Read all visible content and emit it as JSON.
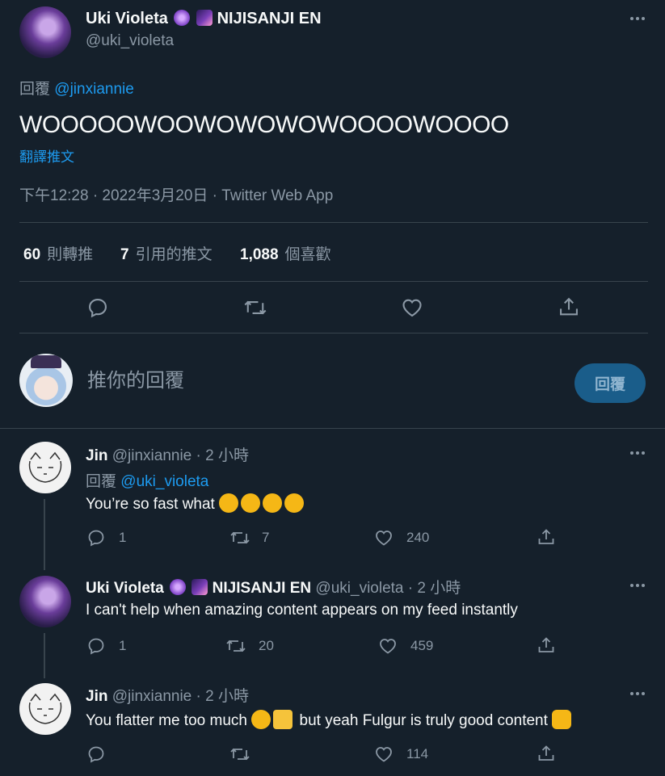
{
  "main_tweet": {
    "author_name": "Uki Violeta",
    "author_suffix": "NIJISANJI EN",
    "author_handle": "@uki_violeta",
    "reply_prefix": "回覆",
    "reply_to": "@jinxiannie",
    "text": "WOOOOOWOOWOWOWOWOOOOWOOOO",
    "translate": "翻譯推文",
    "timestamp": "下午12:28 · 2022年3月20日 · Twitter Web App",
    "retweets_count": "60",
    "retweets_label": "則轉推",
    "quotes_count": "7",
    "quotes_label": "引用的推文",
    "likes_count": "1,088",
    "likes_label": "個喜歡"
  },
  "compose": {
    "placeholder": "推你的回覆",
    "button_label": "回覆"
  },
  "replies": [
    {
      "author_name": "Jin",
      "author_handle": "@jinxiannie",
      "time": "· 2 小時",
      "reply_prefix": "回覆",
      "reply_to": "@uki_violeta",
      "text": "You’re so fast what",
      "reply_count": "1",
      "retweet_count": "7",
      "like_count": "240"
    },
    {
      "author_name": "Uki Violeta",
      "author_suffix": "NIJISANJI EN",
      "author_handle": "@uki_violeta",
      "time": "· 2 小時",
      "text": "I can't help when amazing content appears on my feed instantly",
      "reply_count": "1",
      "retweet_count": "20",
      "like_count": "459"
    },
    {
      "author_name": "Jin",
      "author_handle": "@jinxiannie",
      "time": "· 2 小時",
      "text_a": "You flatter me too much",
      "text_b": "but yeah Fulgur is truly good content",
      "reply_count": "",
      "retweet_count": "",
      "like_count": "114"
    }
  ],
  "colors": {
    "background": "#15202b",
    "accent": "#1d9bf0",
    "reply_button": "#1a5d8a",
    "divider": "#38444d",
    "muted_text": "#8b98a5"
  }
}
